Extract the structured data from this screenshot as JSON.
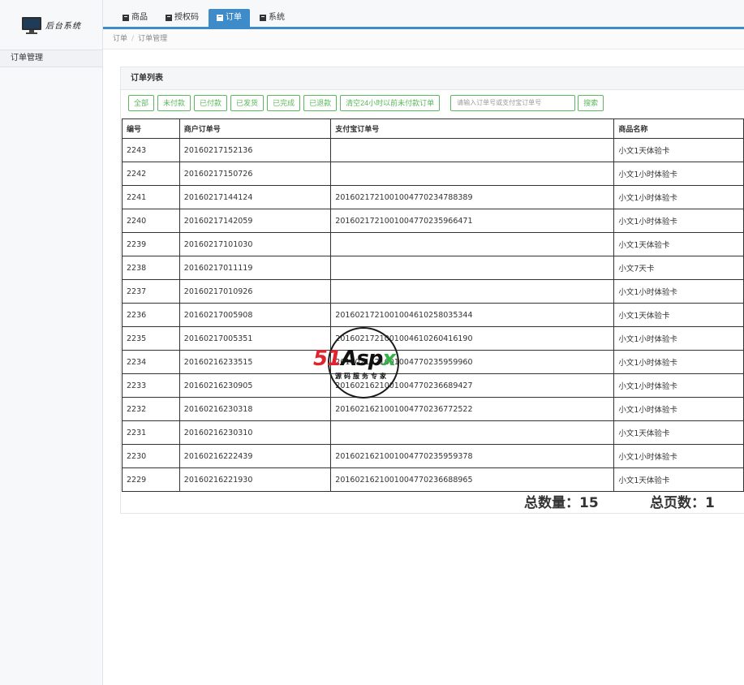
{
  "sidebar": {
    "brand_text": "后台系统",
    "section_label": "订单管理"
  },
  "topbar": {
    "tabs": [
      {
        "label": "商品"
      },
      {
        "label": "授权码"
      },
      {
        "label": "订单"
      },
      {
        "label": "系统"
      }
    ]
  },
  "breadcrumb": {
    "items": [
      "订单",
      "订单管理"
    ],
    "separator": "/"
  },
  "panel": {
    "title": "订单列表"
  },
  "toolbar": {
    "buttons": [
      "全部",
      "未付款",
      "已付款",
      "已发货",
      "已完成",
      "已退款",
      "清空24小时以前未付款订单"
    ],
    "search_placeholder": "请输入订单号或支付宝订单号",
    "search_button": "搜索"
  },
  "table": {
    "headers": [
      "编号",
      "商户订单号",
      "支付宝订单号",
      "商品名称"
    ],
    "rows": [
      [
        "2243",
        "20160217152136",
        "",
        "小文1天体验卡"
      ],
      [
        "2242",
        "20160217150726",
        "",
        "小文1小时体验卡"
      ],
      [
        "2241",
        "20160217144124",
        "2016021721001004770234788389",
        "小文1小时体验卡"
      ],
      [
        "2240",
        "20160217142059",
        "2016021721001004770235966471",
        "小文1小时体验卡"
      ],
      [
        "2239",
        "20160217101030",
        "",
        "小文1天体验卡"
      ],
      [
        "2238",
        "20160217011119",
        "",
        "小文7天卡"
      ],
      [
        "2237",
        "20160217010926",
        "",
        "小文1小时体验卡"
      ],
      [
        "2236",
        "20160217005908",
        "2016021721001004610258035344",
        "小文1天体验卡"
      ],
      [
        "2235",
        "20160217005351",
        "2016021721001004610260416190",
        "小文1小时体验卡"
      ],
      [
        "2234",
        "20160216233515",
        "2016021621001004770235959960",
        "小文1小时体验卡"
      ],
      [
        "2233",
        "20160216230905",
        "2016021621001004770236689427",
        "小文1小时体验卡"
      ],
      [
        "2232",
        "20160216230318",
        "2016021621001004770236772522",
        "小文1小时体验卡"
      ],
      [
        "2231",
        "20160216230310",
        "",
        "小文1天体验卡"
      ],
      [
        "2230",
        "20160216222439",
        "2016021621001004770235959378",
        "小文1小时体验卡"
      ],
      [
        "2229",
        "20160216221930",
        "2016021621001004770236688965",
        "小文1天体验卡"
      ]
    ]
  },
  "totals": {
    "count_text": "总数量：15",
    "pages_text": "总页数：1"
  },
  "watermark": {
    "logo_part1": "51",
    "logo_part2": "Asp",
    "logo_part3": "x",
    "subtitle": "源码服务专家"
  },
  "colors": {
    "accent": "#3e8bc9",
    "button_green": "#5cb85c",
    "watermark_red": "#e0232e",
    "watermark_green": "#35b34a"
  }
}
